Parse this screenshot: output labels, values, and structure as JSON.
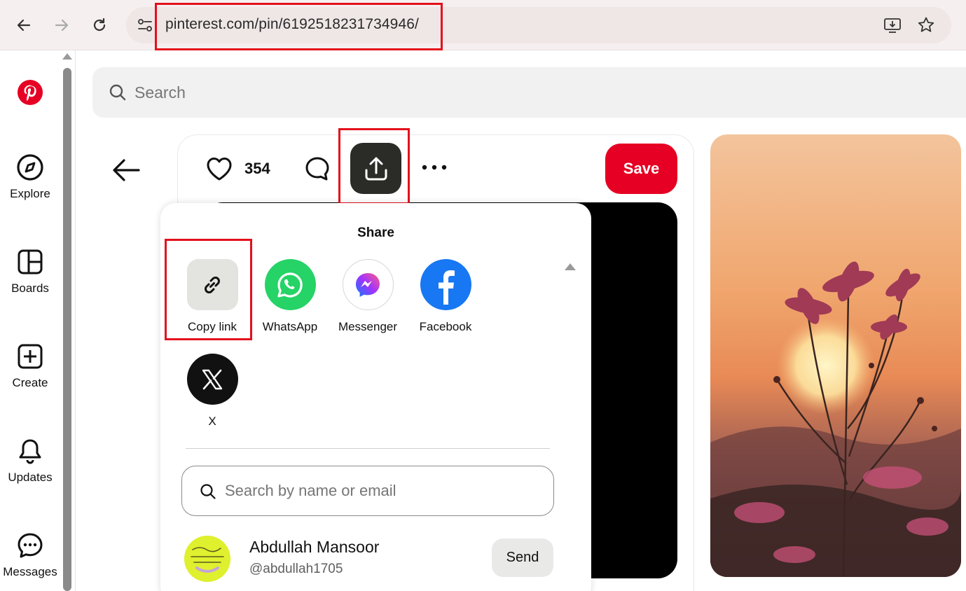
{
  "browser": {
    "url": "pinterest.com/pin/6192518231734946/",
    "back_icon": "arrow-left-icon",
    "forward_icon": "arrow-right-icon",
    "reload_icon": "reload-icon"
  },
  "sidebar": {
    "logo": "pinterest-logo",
    "items": [
      {
        "label": "Explore",
        "icon": "compass-icon"
      },
      {
        "label": "Boards",
        "icon": "boards-icon"
      },
      {
        "label": "Create",
        "icon": "plus-square-icon"
      },
      {
        "label": "Updates",
        "icon": "bell-icon"
      },
      {
        "label": "Messages",
        "icon": "chat-icon"
      }
    ]
  },
  "search": {
    "placeholder": "Search"
  },
  "pin": {
    "like_count": "354",
    "save_label": "Save"
  },
  "share": {
    "title": "Share",
    "options": [
      {
        "label": "Copy link",
        "icon": "link-icon"
      },
      {
        "label": "WhatsApp",
        "icon": "whatsapp-icon",
        "color": "#25d366"
      },
      {
        "label": "Messenger",
        "icon": "messenger-icon"
      },
      {
        "label": "Facebook",
        "icon": "facebook-icon",
        "color": "#1877f2"
      },
      {
        "label": "X",
        "icon": "x-icon",
        "color": "#000000"
      }
    ],
    "people_search_placeholder": "Search by name or email",
    "contact": {
      "name": "Abdullah Mansoor",
      "handle": "@abdullah1705",
      "send_label": "Send"
    }
  },
  "colors": {
    "brand": "#e60023",
    "highlight": "#e3101c"
  }
}
